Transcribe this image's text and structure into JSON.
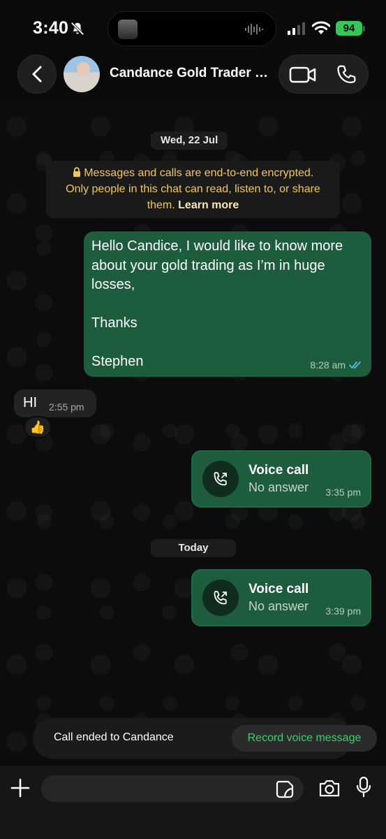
{
  "status_bar": {
    "time": "3:40",
    "battery": "94"
  },
  "header": {
    "contact_name": "Candance Gold Trader J...",
    "icons": {
      "back": "chevron-left-icon",
      "video": "video-camera-icon",
      "phone": "phone-icon"
    }
  },
  "chat": {
    "date_separator_1": "Wed, 22 Jul",
    "encryption_notice": {
      "line1": "Messages and calls are end-to-end encrypted.",
      "line2": "Only people in this chat can read, listen to, or share",
      "line3": "them.",
      "learn_more": "Learn more"
    },
    "message_out_1": {
      "text": "Hello Candice, I would like to know more\nabout your gold trading as I’m in huge\nlosses,\n\nThanks\n\nStephen",
      "time": "8:28 am",
      "status": "read"
    },
    "message_in_1": {
      "text": "HI",
      "time": "2:55 pm",
      "reaction": "👍"
    },
    "call_1": {
      "title": "Voice call",
      "subtitle": "No answer",
      "time": "3:35 pm"
    },
    "date_separator_2": "Today",
    "call_2": {
      "title": "Voice call",
      "subtitle": "No answer",
      "time": "3:39 pm"
    }
  },
  "toast": {
    "text": "Call ended to  Candance",
    "action": "Record voice message"
  },
  "composer": {
    "placeholder": "",
    "icons": {
      "attach": "plus-icon",
      "sticker": "sticker-icon",
      "camera": "camera-icon",
      "mic": "microphone-icon"
    }
  },
  "colors": {
    "outgoing_bubble": "#1d5c3c",
    "incoming_bubble": "#232323",
    "accent_green": "#3ecf6a",
    "encryption_text": "#f2c85a",
    "read_ticks": "#53bdeb"
  }
}
